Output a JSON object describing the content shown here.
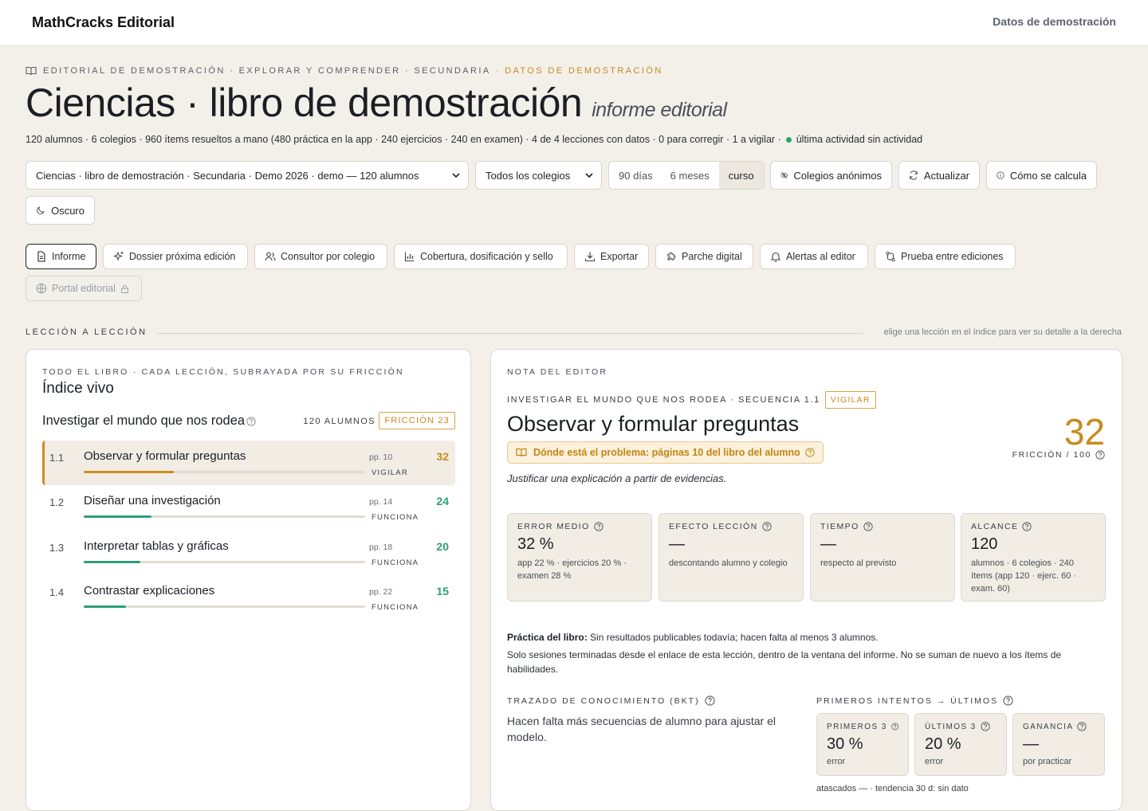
{
  "header": {
    "brand": "MathCracks Editorial",
    "demo_link": "Datos de demostración"
  },
  "breadcrumb": {
    "text": "EDITORIAL DE DEMOSTRACIÓN · EXPLORAR Y COMPRENDER · SECUNDARIA",
    "accent": "· DATOS DE DEMOSTRACIÓN"
  },
  "page": {
    "title": "Ciencias · libro de demostración",
    "subtitle": "informe editorial",
    "meta": "120 alumnos · 6 colegios · 960 ítems resueltos a mano (480 práctica en la app · 240 ejercicios · 240 en examen) · 4 de 4 lecciones con datos · 0 para corregir · 1 a vigilar ·",
    "last_activity": "última actividad sin actividad"
  },
  "controls": {
    "book_select": "Ciencias · libro de demostración · Secundaria · Demo 2026 · demo — 120 alumnos",
    "school_select": "Todos los colegios",
    "periods": [
      "90 días",
      "6 meses",
      "curso"
    ],
    "active_period": "curso",
    "anonymous": "Colegios anónimos",
    "refresh": "Actualizar",
    "how": "Cómo se calcula",
    "dark": "Oscuro"
  },
  "tabs": {
    "report": "Informe",
    "dossier": "Dossier próxima edición",
    "consultant": "Consultor por colegio",
    "coverage": "Cobertura, dosificación y sello",
    "export": "Exportar",
    "patch": "Parche digital",
    "alerts": "Alertas al editor",
    "test": "Prueba entre ediciones",
    "portal": "Portal editorial"
  },
  "section": {
    "label": "LECCIÓN A LECCIÓN",
    "hint": "elige una lección en el índice para ver su detalle a la derecha"
  },
  "index": {
    "eyebrow": "TODO EL LIBRO · CADA LECCIÓN, SUBRAYADA POR SU FRICCIÓN",
    "title": "Índice vivo",
    "unit_name": "Investigar el mundo que nos rodea",
    "unit_students": "120 ALUMNOS",
    "unit_friction": "FRICCIÓN 23",
    "lessons": [
      {
        "num": "1.1",
        "name": "Observar y formular preguntas",
        "pages": "pp. 10",
        "status": "VIGILAR",
        "score": "32",
        "friction": 32
      },
      {
        "num": "1.2",
        "name": "Diseñar una investigación",
        "pages": "pp. 14",
        "status": "FUNCIONA",
        "score": "24",
        "friction": 24
      },
      {
        "num": "1.3",
        "name": "Interpretar tablas y gráficas",
        "pages": "pp. 18",
        "status": "FUNCIONA",
        "score": "20",
        "friction": 20
      },
      {
        "num": "1.4",
        "name": "Contrastar explicaciones",
        "pages": "pp. 22",
        "status": "FUNCIONA",
        "score": "15",
        "friction": 15
      }
    ]
  },
  "detail": {
    "eyebrow": "NOTA DEL EDITOR",
    "crumb": "INVESTIGAR EL MUNDO QUE NOS RODEA · SECUENCIA 1.1",
    "badge": "VIGILAR",
    "title": "Observar y formular preguntas",
    "problem": "Dónde está el problema: páginas 10 del libro del alumno",
    "goal": "Justificar una explicación a partir de evidencias.",
    "score": "32",
    "score_label": "FRICCIÓN / 100",
    "cards": [
      {
        "label": "ERROR MEDIO",
        "value": "32 %",
        "note": "app 22 % · ejercicios 20 % · examen 28 %"
      },
      {
        "label": "EFECTO LECCIÓN",
        "value": "—",
        "note": "descontando alumno y colegio"
      },
      {
        "label": "TIEMPO",
        "value": "—",
        "note": "respecto al previsto"
      },
      {
        "label": "ALCANCE",
        "value": "120",
        "note": "alumnos · 6 colegios · 240 ítems (app 120 · ejerc. 60 · exam. 60)"
      }
    ],
    "practice_label": "Práctica del libro:",
    "practice_text": "Sin resultados publicables todavía; hacen falta al menos 3 alumnos.",
    "practice_note": "Solo sesiones terminadas desde el enlace de esta lección, dentro de la ventana del informe. No se suman de nuevo a los ítems de habilidades.",
    "bkt_label": "TRAZADO DE CONOCIMIENTO (BKT)",
    "bkt_text": "Hacen falta más secuencias de alumno para ajustar el modelo.",
    "fl_label": "PRIMEROS INTENTOS → ÚLTIMOS",
    "mini": [
      {
        "label": "PRIMEROS 3",
        "value": "30 %",
        "note": "error"
      },
      {
        "label": "ÚLTIMOS 3",
        "value": "20 %",
        "note": "error"
      },
      {
        "label": "GANANCIA",
        "value": "—",
        "note": "por practicar"
      }
    ],
    "stuck": "atascados — · tendencia 30 d: sin dato"
  },
  "colors": {
    "accent": "#c98a1d",
    "ok": "#2e9e7c",
    "warn": "#d08a1f",
    "bg": "#f3f0ea"
  }
}
